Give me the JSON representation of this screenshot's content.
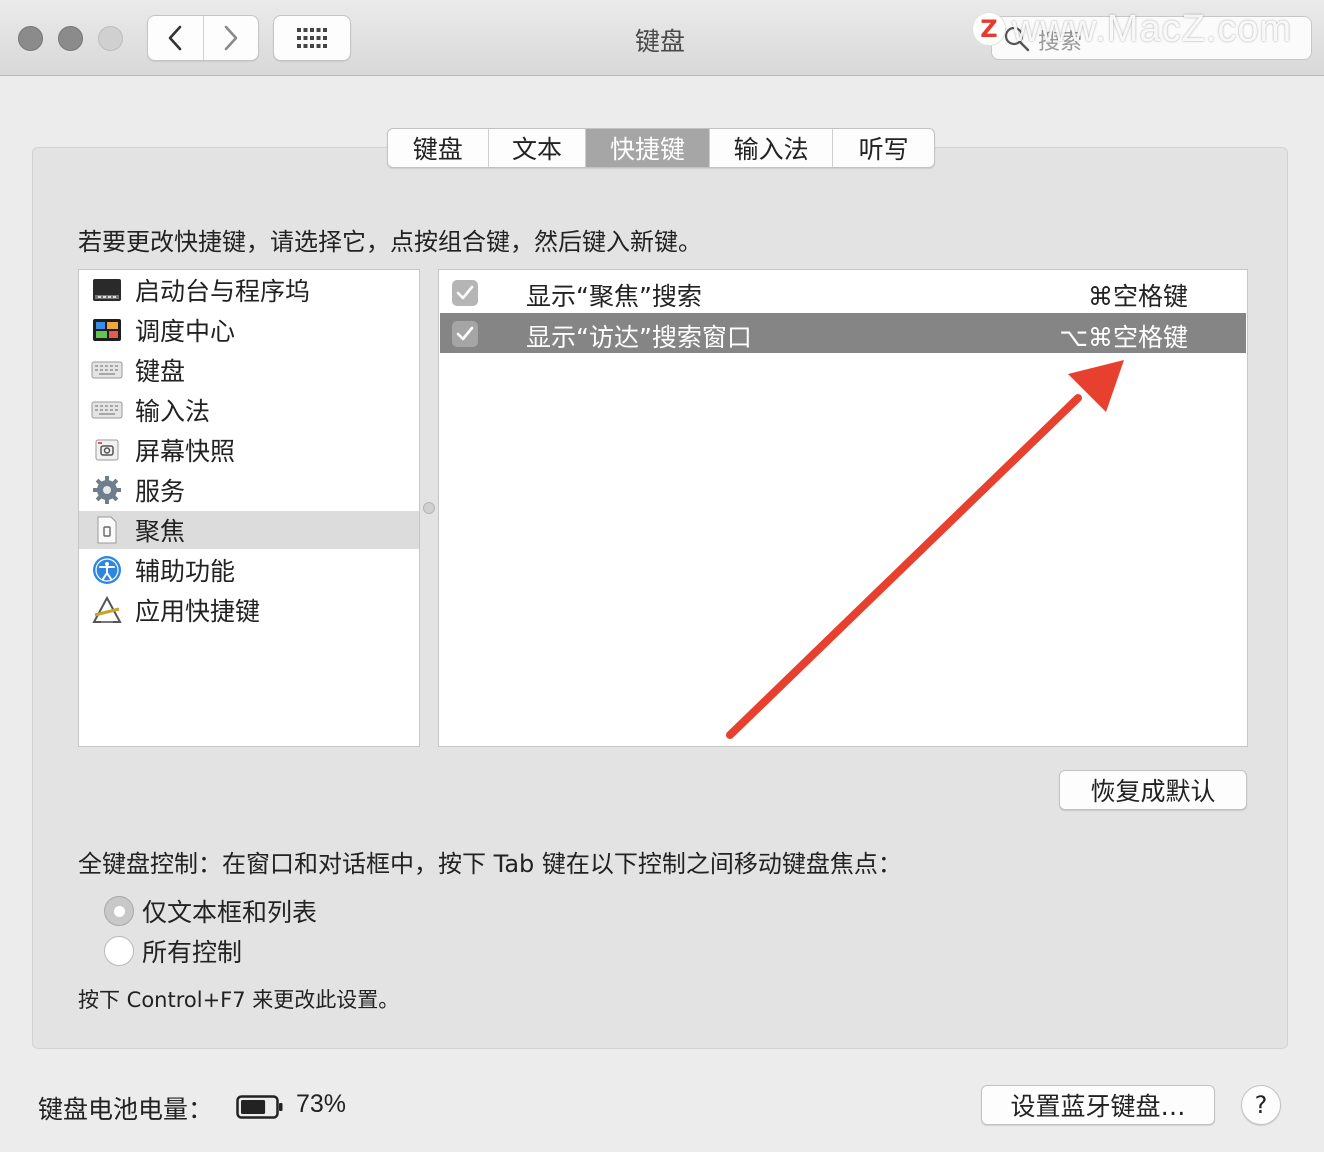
{
  "window": {
    "title": "键盘",
    "search_placeholder": "搜索",
    "watermark_text": "www.MacZ.com",
    "watermark_logo": "Z"
  },
  "tabs": [
    {
      "label": "键盘",
      "active": false
    },
    {
      "label": "文本",
      "active": false
    },
    {
      "label": "快捷键",
      "active": true
    },
    {
      "label": "输入法",
      "active": false
    },
    {
      "label": "听写",
      "active": false
    }
  ],
  "instruction": "若要更改快捷键，请选择它，点按组合键，然后键入新键。",
  "categories": [
    {
      "label": "启动台与程序坞",
      "icon": "dock-icon"
    },
    {
      "label": "调度中心",
      "icon": "mission-control-icon"
    },
    {
      "label": "键盘",
      "icon": "keyboard-icon"
    },
    {
      "label": "输入法",
      "icon": "keyboard-icon"
    },
    {
      "label": "屏幕快照",
      "icon": "screenshot-icon"
    },
    {
      "label": "服务",
      "icon": "gear-icon"
    },
    {
      "label": "聚焦",
      "icon": "spotlight-icon",
      "selected": true
    },
    {
      "label": "辅助功能",
      "icon": "accessibility-icon"
    },
    {
      "label": "应用快捷键",
      "icon": "app-shortcuts-icon"
    }
  ],
  "shortcuts": [
    {
      "label": "显示“聚焦”搜索",
      "keys": "⌘空格键",
      "checked": true,
      "selected": false
    },
    {
      "label": "显示“访达”搜索窗口",
      "keys": "⌥⌘空格键",
      "checked": true,
      "selected": true
    }
  ],
  "restore_button": "恢复成默认",
  "full_keyboard": {
    "label": "全键盘控制：在窗口和对话框中，按下 Tab 键在以下控制之间移动键盘焦点：",
    "options": [
      {
        "label": "仅文本框和列表",
        "selected": true
      },
      {
        "label": "所有控制",
        "selected": false
      }
    ],
    "hint": "按下 Control+F7 来更改此设置。"
  },
  "battery": {
    "label": "键盘电池电量：",
    "value": "73%",
    "level": 0.73
  },
  "bluetooth_button": "设置蓝牙键盘…",
  "help_button": "?",
  "colors": {
    "annotation_arrow": "#e8402e",
    "selected_row": "#858585",
    "active_tab": "#a6a6a6"
  }
}
